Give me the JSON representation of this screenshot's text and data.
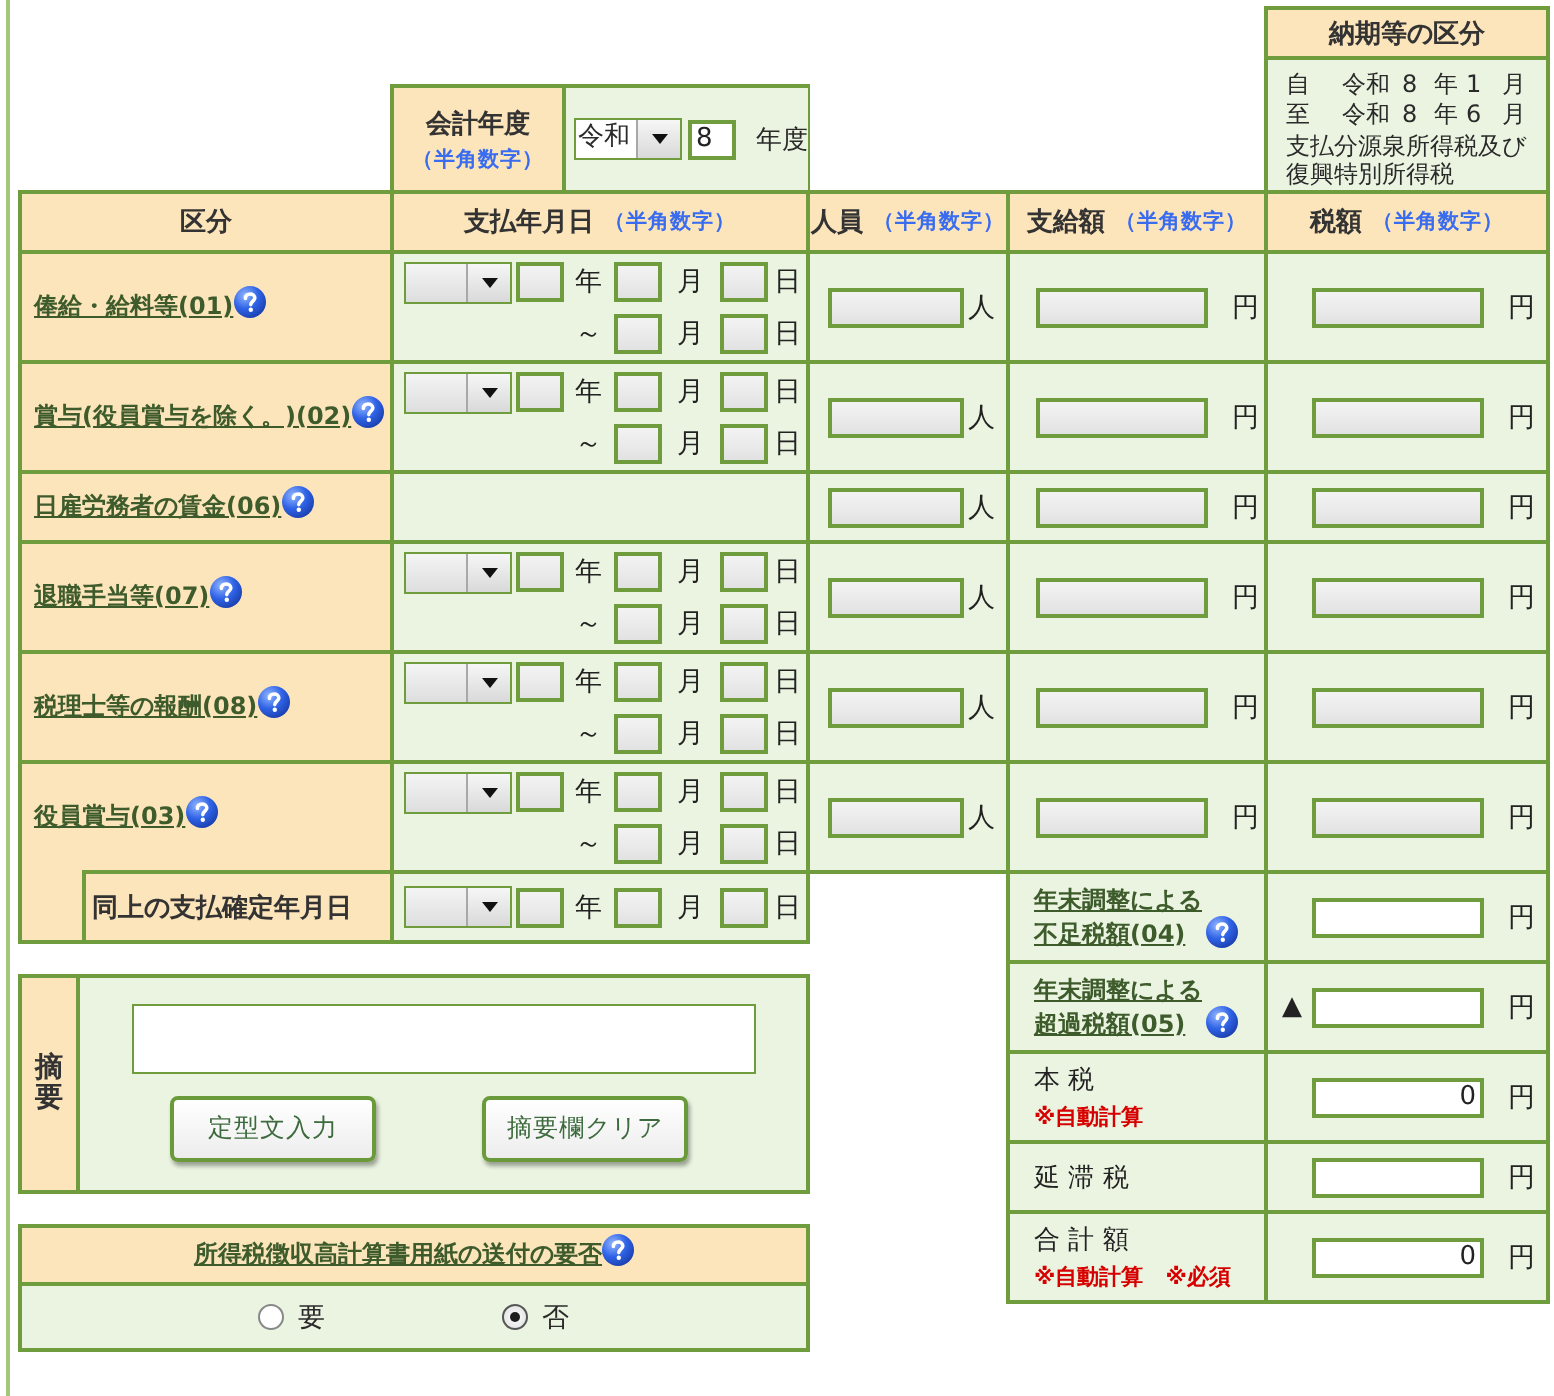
{
  "fiscal_year": {
    "label": "会計年度",
    "note": "（半角数字）",
    "era": "令和",
    "year": "8",
    "unit": "年度"
  },
  "period": {
    "title": "納期等の区分",
    "rows": [
      {
        "label": "自",
        "era": "令和",
        "year": "8",
        "year_unit": "年",
        "month": "1",
        "month_unit": "月"
      },
      {
        "label": "至",
        "era": "令和",
        "year": "8",
        "year_unit": "年",
        "month": "6",
        "month_unit": "月"
      }
    ],
    "description": "支払分源泉所得税及び復興特別所得税"
  },
  "table": {
    "columns": [
      {
        "label": "区分"
      },
      {
        "label": "支払年月日",
        "note": "（半角数字）"
      },
      {
        "label": "人員",
        "note": "（半角数字）"
      },
      {
        "label": "支給額",
        "note": "（半角数字）"
      },
      {
        "label": "税額",
        "note": "（半角数字）"
      }
    ],
    "rows": [
      {
        "kind": "dated",
        "label": "俸給・給料等(01)",
        "date": {
          "year_unit": "年",
          "month_unit": "月",
          "day_unit": "日",
          "range_mark": "～",
          "end_month_unit": "月",
          "end_day_unit": "日"
        },
        "people_unit": "人",
        "paid_unit": "円",
        "tax_unit": "円"
      },
      {
        "kind": "dated",
        "label": "賞与(役員賞与を除く。)(02)",
        "date": {
          "year_unit": "年",
          "month_unit": "月",
          "day_unit": "日",
          "range_mark": "～",
          "end_month_unit": "月",
          "end_day_unit": "日"
        },
        "people_unit": "人",
        "paid_unit": "円",
        "tax_unit": "円"
      },
      {
        "kind": "undated",
        "label": "日雇労務者の賃金(06)",
        "people_unit": "人",
        "paid_unit": "円",
        "tax_unit": "円"
      },
      {
        "kind": "dated",
        "label": "退職手当等(07)",
        "date": {
          "year_unit": "年",
          "month_unit": "月",
          "day_unit": "日",
          "range_mark": "～",
          "end_month_unit": "月",
          "end_day_unit": "日"
        },
        "people_unit": "人",
        "paid_unit": "円",
        "tax_unit": "円"
      },
      {
        "kind": "dated",
        "label": "税理士等の報酬(08)",
        "date": {
          "year_unit": "年",
          "month_unit": "月",
          "day_unit": "日",
          "range_mark": "～",
          "end_month_unit": "月",
          "end_day_unit": "日"
        },
        "people_unit": "人",
        "paid_unit": "円",
        "tax_unit": "円"
      },
      {
        "kind": "dated",
        "label": "役員賞与(03)",
        "date": {
          "year_unit": "年",
          "month_unit": "月",
          "day_unit": "日",
          "range_mark": "～",
          "end_month_unit": "月",
          "end_day_unit": "日"
        },
        "people_unit": "人",
        "paid_unit": "円",
        "tax_unit": "円"
      }
    ]
  },
  "confirmed_date": {
    "label": "同上の支払確定年月日",
    "date": {
      "year_unit": "年",
      "month_unit": "月",
      "day_unit": "日"
    }
  },
  "summary": {
    "label": "摘要",
    "buttons": [
      "定型文入力",
      "摘要欄クリア"
    ]
  },
  "mailing": {
    "title": "所得税徴収高計算書用紙の送付の要否",
    "options": [
      {
        "label": "要",
        "selected": false
      },
      {
        "label": "否",
        "selected": true
      }
    ]
  },
  "totals": [
    {
      "kind": "link",
      "label": "年末調整による不足税額(04)",
      "unit": "円"
    },
    {
      "kind": "link",
      "label": "年末調整による超過税額(05)",
      "prefix": "▲",
      "unit": "円"
    },
    {
      "kind": "text",
      "label": "本 税",
      "note": "※自動計算",
      "value": "0",
      "unit": "円"
    },
    {
      "kind": "text",
      "label": "延 滞 税",
      "unit": "円"
    },
    {
      "kind": "text",
      "label": "合 計 額",
      "note": "※自動計算　※必須",
      "value": "0",
      "unit": "円"
    }
  ]
}
